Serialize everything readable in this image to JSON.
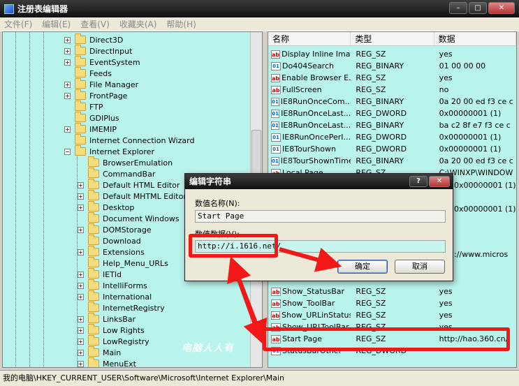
{
  "window": {
    "title": "注册表编辑器",
    "buttons": [
      "–",
      "□",
      "✕"
    ]
  },
  "menu": [
    "文件(F)",
    "编辑(E)",
    "查看(V)",
    "收藏夹(A)",
    "帮助(H)"
  ],
  "tree": [
    {
      "label": "Direct3D",
      "expander": "+"
    },
    {
      "label": "DirectInput",
      "expander": "+"
    },
    {
      "label": "EventSystem",
      "expander": "+"
    },
    {
      "label": "Feeds",
      "expander": ""
    },
    {
      "label": "File Manager",
      "expander": "+"
    },
    {
      "label": "FrontPage",
      "expander": "+"
    },
    {
      "label": "FTP",
      "expander": ""
    },
    {
      "label": "GDIPlus",
      "expander": ""
    },
    {
      "label": "IMEMIP",
      "expander": "+"
    },
    {
      "label": "Internet Connection Wizard",
      "expander": ""
    },
    {
      "label": "Internet Explorer",
      "expander": "−"
    },
    {
      "label": "BrowserEmulation",
      "expander": ""
    },
    {
      "label": "CommandBar",
      "expander": ""
    },
    {
      "label": "Default HTML Editor",
      "expander": "+"
    },
    {
      "label": "Default MHTML Editor",
      "expander": "+"
    },
    {
      "label": "Desktop",
      "expander": "+"
    },
    {
      "label": "Document Windows",
      "expander": ""
    },
    {
      "label": "DOMStorage",
      "expander": "+"
    },
    {
      "label": "Download",
      "expander": ""
    },
    {
      "label": "Extensions",
      "expander": "+"
    },
    {
      "label": "Help_Menu_URLs",
      "expander": ""
    },
    {
      "label": "IETld",
      "expander": "+"
    },
    {
      "label": "IntelliForms",
      "expander": "+"
    },
    {
      "label": "International",
      "expander": "+"
    },
    {
      "label": "InternetRegistry",
      "expander": ""
    },
    {
      "label": "LinksBar",
      "expander": "+"
    },
    {
      "label": "Low Rights",
      "expander": "+"
    },
    {
      "label": "LowRegistry",
      "expander": "+"
    },
    {
      "label": "Main",
      "expander": "+"
    },
    {
      "label": "MenuExt",
      "expander": "+"
    }
  ],
  "list_headers": [
    "名称",
    "类型",
    "数据"
  ],
  "values": [
    {
      "name": "Display Inline Ima...",
      "type": "REG_SZ",
      "data": "yes",
      "icon": "ab"
    },
    {
      "name": "Do404Search",
      "type": "REG_BINARY",
      "data": "01 00 00 00",
      "icon": "bin"
    },
    {
      "name": "Enable Browser E...",
      "type": "REG_SZ",
      "data": "yes",
      "icon": "ab"
    },
    {
      "name": "FullScreen",
      "type": "REG_SZ",
      "data": "no",
      "icon": "ab"
    },
    {
      "name": "IE8RunOnceCom...",
      "type": "REG_BINARY",
      "data": "0a 20 00 ed f3 ce c",
      "icon": "bin"
    },
    {
      "name": "IE8RunOnceLast...",
      "type": "REG_DWORD",
      "data": "0x00000001 (1)",
      "icon": "bin"
    },
    {
      "name": "IE8RunOnceLast...",
      "type": "REG_BINARY",
      "data": "ba c2 8f e7 f3 ce c",
      "icon": "bin"
    },
    {
      "name": "IE8RunOncePerI...",
      "type": "REG_DWORD",
      "data": "0x00000001 (1)",
      "icon": "bin"
    },
    {
      "name": "IE8TourShown",
      "type": "REG_DWORD",
      "data": "0x00000001 (1)",
      "icon": "bin"
    },
    {
      "name": "IE8TourShownTime",
      "type": "REG_BINARY",
      "data": "0a 20 00 ed f3 ce c",
      "icon": "bin"
    },
    {
      "name": "Local Page",
      "type": "REG_SZ",
      "data": "C:\\WINXP\\WINDOW",
      "icon": "ab"
    }
  ],
  "values_lower": [
    {
      "name": "Show_StatusBar",
      "type": "REG_SZ",
      "data": "yes",
      "icon": "ab"
    },
    {
      "name": "Show_ToolBar",
      "type": "REG_SZ",
      "data": "yes",
      "icon": "ab"
    },
    {
      "name": "Show_URLinStatusBar",
      "type": "REG_SZ",
      "data": "yes",
      "icon": "ab"
    },
    {
      "name": "Show_URLToolBar",
      "type": "REG_SZ",
      "data": "yes",
      "icon": "ab"
    },
    {
      "name": "Start Page",
      "type": "REG_SZ",
      "data": "http://hao.360.cn/",
      "icon": "ab"
    },
    {
      "name": "StatusBarOther",
      "type": "REG_DWORD",
      "data": "",
      "icon": "bin"
    }
  ],
  "partial_data": [
    "0x00000001 (1)",
    "0x00000001 (1)",
    "://www.micros"
  ],
  "dialog": {
    "title": "编辑字符串",
    "name_label": "数值名称(N):",
    "name_value": "Start Page",
    "data_label": "数值数据(V):",
    "data_value": "http://i.1616.net/",
    "ok": "确定",
    "cancel": "取消"
  },
  "status": "我的电脑\\HKEY_CURRENT_USER\\Software\\Microsoft\\Internet Explorer\\Main",
  "watermark": "电脑人人有",
  "colors": {
    "pane_bg": "#b8f4ec",
    "highlight": "#f21818"
  }
}
